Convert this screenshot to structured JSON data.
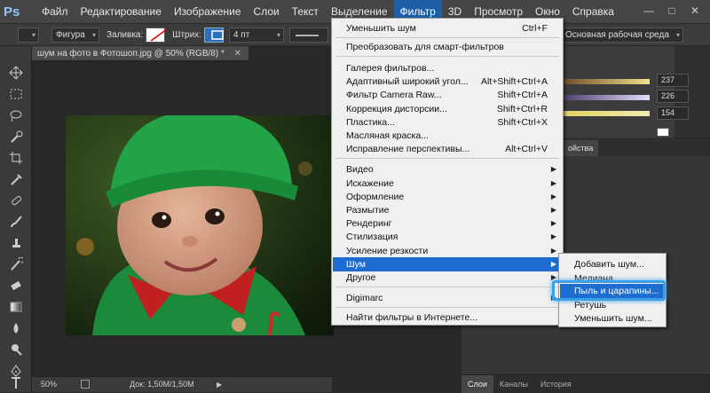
{
  "app": {
    "logo": "Ps"
  },
  "menubar": {
    "items": [
      "Файл",
      "Редактирование",
      "Изображение",
      "Слои",
      "Текст",
      "Выделение",
      "Фильтр",
      "3D",
      "Просмотр",
      "Окно",
      "Справка"
    ],
    "active_index": 6
  },
  "options_bar": {
    "shape_mode": "Фигура",
    "fill_label": "Заливка:",
    "stroke_label": "Штрих:",
    "stroke_width": "4 пт",
    "workspace": "Основная рабочая среда"
  },
  "document": {
    "tab_title": "шум на фото в Фотошоп.jpg @ 50% (RGB/8) *",
    "zoom": "50%",
    "doc_size": "Док: 1,50M/1,50M"
  },
  "color_panel": {
    "values": [
      "237",
      "226",
      "154"
    ]
  },
  "panels": {
    "header_fragment": "ойства",
    "bottom_tabs": [
      "Слои",
      "Каналы",
      "История"
    ]
  },
  "filter_menu": {
    "groups": [
      [
        {
          "label": "Уменьшить шум",
          "shortcut": "Ctrl+F"
        }
      ],
      [
        {
          "label": "Преобразовать для смарт-фильтров",
          "shortcut": ""
        }
      ],
      [
        {
          "label": "Галерея фильтров...",
          "shortcut": ""
        },
        {
          "label": "Адаптивный широкий угол...",
          "shortcut": "Alt+Shift+Ctrl+A"
        },
        {
          "label": "Фильтр Camera Raw...",
          "shortcut": "Shift+Ctrl+A"
        },
        {
          "label": "Коррекция дисторсии...",
          "shortcut": "Shift+Ctrl+R"
        },
        {
          "label": "Пластика...",
          "shortcut": "Shift+Ctrl+X"
        },
        {
          "label": "Масляная краска...",
          "shortcut": ""
        },
        {
          "label": "Исправление перспективы...",
          "shortcut": "Alt+Ctrl+V"
        }
      ],
      [
        {
          "label": "Видео",
          "submenu": true
        },
        {
          "label": "Искажение",
          "submenu": true
        },
        {
          "label": "Оформление",
          "submenu": true
        },
        {
          "label": "Размытие",
          "submenu": true
        },
        {
          "label": "Рендеринг",
          "submenu": true
        },
        {
          "label": "Стилизация",
          "submenu": true
        },
        {
          "label": "Усиление резкости",
          "submenu": true
        },
        {
          "label": "Шум",
          "submenu": true,
          "highlighted": true
        },
        {
          "label": "Другое",
          "submenu": true
        }
      ],
      [
        {
          "label": "Digimarc",
          "submenu": true
        }
      ],
      [
        {
          "label": "Найти фильтры в Интернете...",
          "shortcut": ""
        }
      ]
    ]
  },
  "noise_submenu": {
    "items": [
      "Добавить шум...",
      "Медиана...",
      "Пыль и царапины...",
      "Ретушь",
      "Уменьшить шум..."
    ],
    "highlighted_index": 2
  },
  "colors": {
    "menu_highlight": "#1f6cd0",
    "callout": "#3aa0e8"
  }
}
